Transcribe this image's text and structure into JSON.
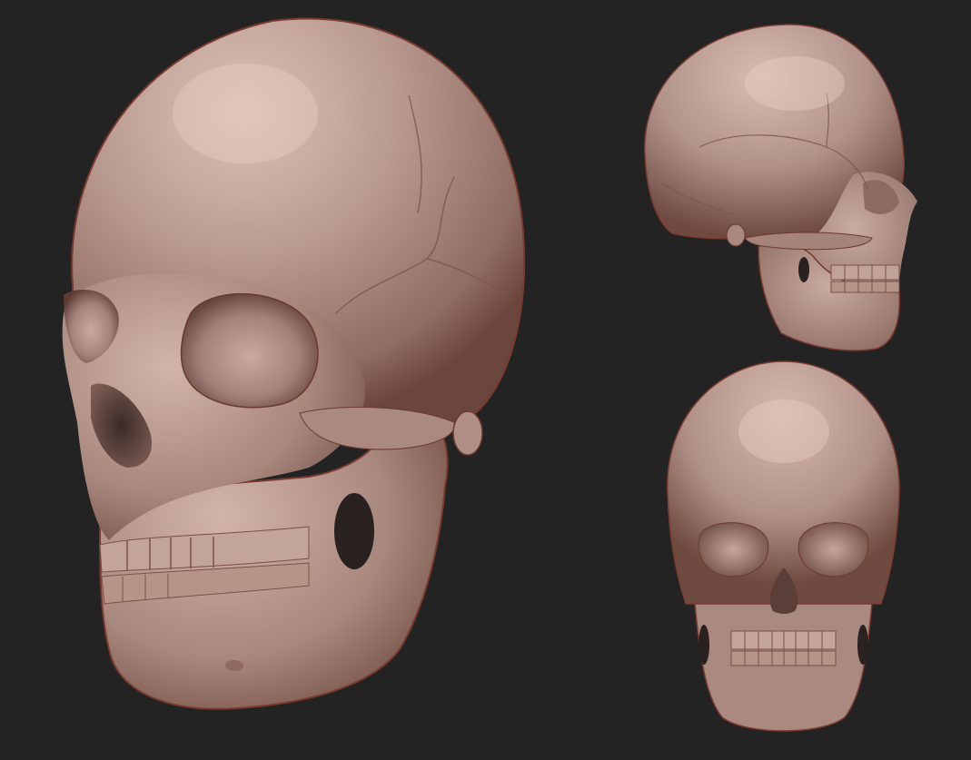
{
  "colors": {
    "background": "#232323",
    "material_base": "#b8978e",
    "material_highlight": "#d9bdb3",
    "material_shadow": "#6e4d45",
    "rim_red": "#8a3a2c",
    "cavity": "#3a2a27"
  },
  "views": [
    {
      "name": "three-quarter-view"
    },
    {
      "name": "side-view"
    },
    {
      "name": "front-view"
    }
  ]
}
